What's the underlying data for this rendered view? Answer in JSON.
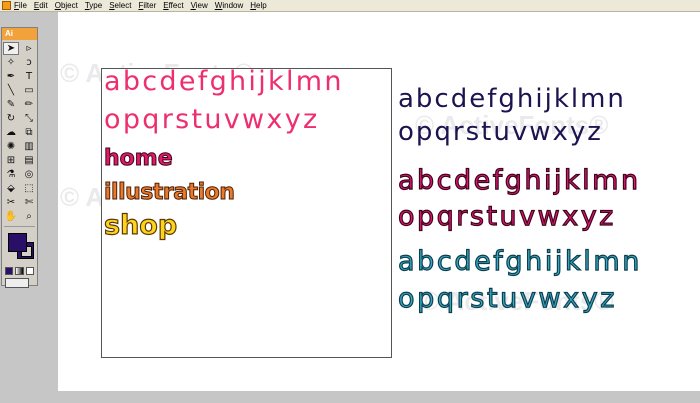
{
  "menu": {
    "app_icon": "illustrator-app-icon",
    "items": [
      "File",
      "Edit",
      "Object",
      "Type",
      "Select",
      "Filter",
      "Effect",
      "View",
      "Window",
      "Help"
    ]
  },
  "toolbox": {
    "header": "Ai",
    "tools": [
      {
        "icon": "selection-arrow-icon",
        "glyph": "➤"
      },
      {
        "icon": "direct-selection-icon",
        "glyph": "▹"
      },
      {
        "icon": "magic-wand-icon",
        "glyph": "✧"
      },
      {
        "icon": "lasso-icon",
        "glyph": "ↄ"
      },
      {
        "icon": "pen-icon",
        "glyph": "✒"
      },
      {
        "icon": "type-icon",
        "glyph": "T"
      },
      {
        "icon": "line-icon",
        "glyph": "╲"
      },
      {
        "icon": "rectangle-icon",
        "glyph": "▭"
      },
      {
        "icon": "paintbrush-icon",
        "glyph": "✎"
      },
      {
        "icon": "pencil-icon",
        "glyph": "✏"
      },
      {
        "icon": "rotate-icon",
        "glyph": "↻"
      },
      {
        "icon": "scale-icon",
        "glyph": "⤡"
      },
      {
        "icon": "warp-icon",
        "glyph": "☁"
      },
      {
        "icon": "free-transform-icon",
        "glyph": "⧉"
      },
      {
        "icon": "symbol-sprayer-icon",
        "glyph": "✺"
      },
      {
        "icon": "graph-icon",
        "glyph": "▥"
      },
      {
        "icon": "mesh-icon",
        "glyph": "⊞"
      },
      {
        "icon": "gradient-icon",
        "glyph": "▤"
      },
      {
        "icon": "eyedropper-icon",
        "glyph": "⚗"
      },
      {
        "icon": "blend-icon",
        "glyph": "◎"
      },
      {
        "icon": "live-paint-icon",
        "glyph": "⬙"
      },
      {
        "icon": "live-paint-selection-icon",
        "glyph": "⬚"
      },
      {
        "icon": "slice-icon",
        "glyph": "✂"
      },
      {
        "icon": "scissors-icon",
        "glyph": "✄"
      },
      {
        "icon": "hand-icon",
        "glyph": "✋"
      },
      {
        "icon": "zoom-icon",
        "glyph": "⌕"
      }
    ],
    "fill_color": "#2a0f68",
    "stroke_color": "#2a0f68"
  },
  "artboard": {
    "alphabet_line1": "abcdefghijklmn",
    "alphabet_line2": "opqrstuvwxyz",
    "word1": "home",
    "word2": "illustration",
    "word3": "shop",
    "pink": "#ee2f6e"
  },
  "samples": {
    "navy_line1": "abcdefghijklmn",
    "navy_line2": "opqrstuvwxyz",
    "magenta_line1": "abcdefghijklmn",
    "magenta_line2": "opqrstuvwxyz",
    "teal_line1": "abcdefghijklmn",
    "teal_line2": "opqrstuvwxyz",
    "navy": "#1e1350",
    "magenta": "#e0147a",
    "teal": "#3aa8c0"
  },
  "watermark": {
    "text": "© ActiveFonts®"
  }
}
